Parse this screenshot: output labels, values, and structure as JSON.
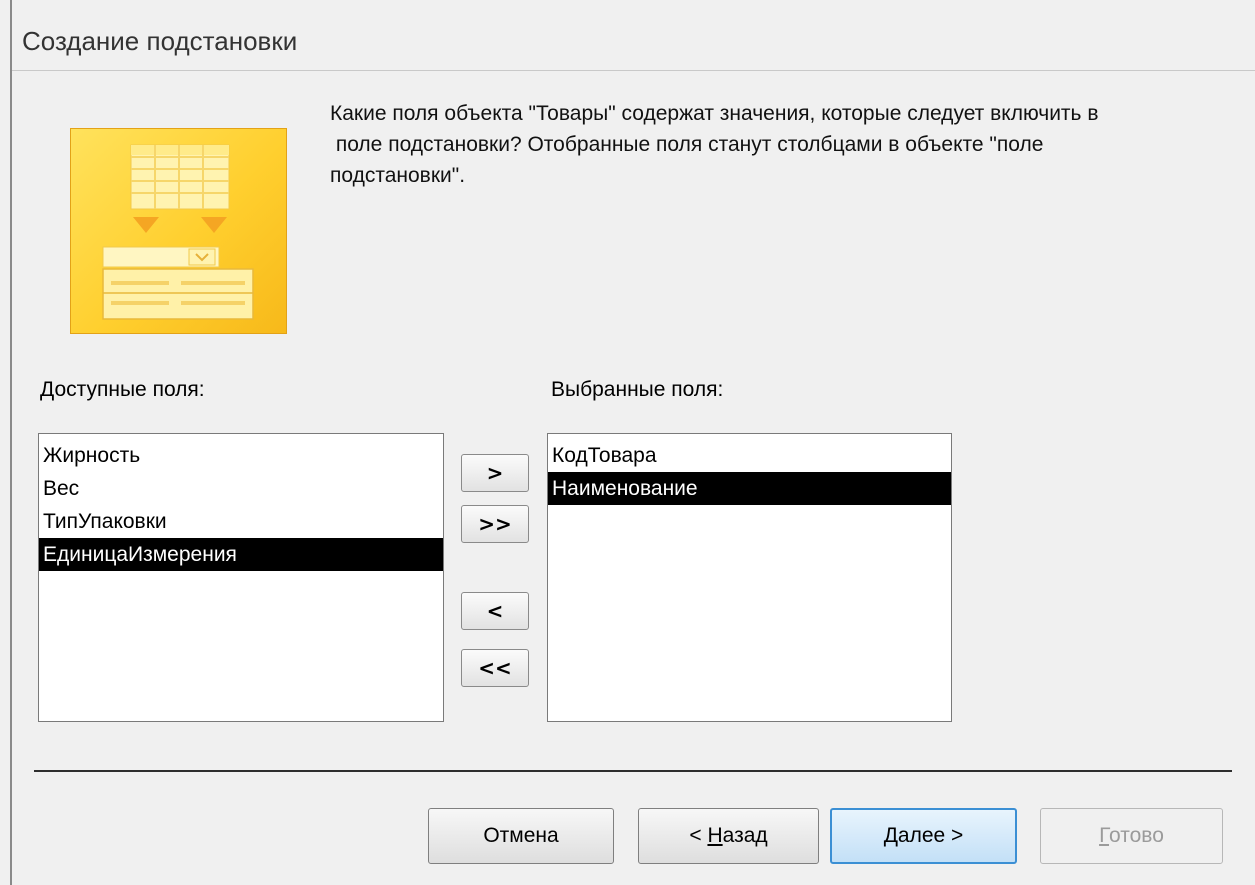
{
  "window": {
    "title": "Создание подстановки"
  },
  "description": {
    "lines": [
      "Какие поля объекта \"Товары\" содержат значения, которые следует включить в",
      " поле подстановки? Отобранные поля станут столбцами в объекте \"поле",
      "подстановки\"."
    ]
  },
  "available_fields": {
    "label": "Доступные поля:",
    "items": [
      "Жирность",
      "Вес",
      "ТипУпаковки",
      "ЕдиницаИзмерения"
    ],
    "selected_item": "ЕдиницаИзмерения"
  },
  "selected_fields": {
    "label": "Выбранные поля:",
    "items": [
      "КодТовара",
      "Наименование"
    ],
    "selected_item": "Наименование"
  },
  "move_buttons": {
    "add_one": ">",
    "add_all": ">>",
    "remove_one": "<",
    "remove_all": "<<"
  },
  "footer": {
    "cancel": "Отмена",
    "back_prefix": "< ",
    "back_underlined": "Н",
    "back_rest": "азад",
    "next_underlined": "Д",
    "next_rest": "алее >",
    "finish_underlined": "Г",
    "finish_rest": "отово",
    "finish_enabled": false
  },
  "icons": {
    "wizard": "lookup-wizard-icon"
  },
  "colors": {
    "selection_bg": "#000000",
    "selection_fg": "#ffffff",
    "default_button_border": "#3b8fd4",
    "disabled_text": "#9b9b9b",
    "icon_fill": "#ffcf2e"
  }
}
